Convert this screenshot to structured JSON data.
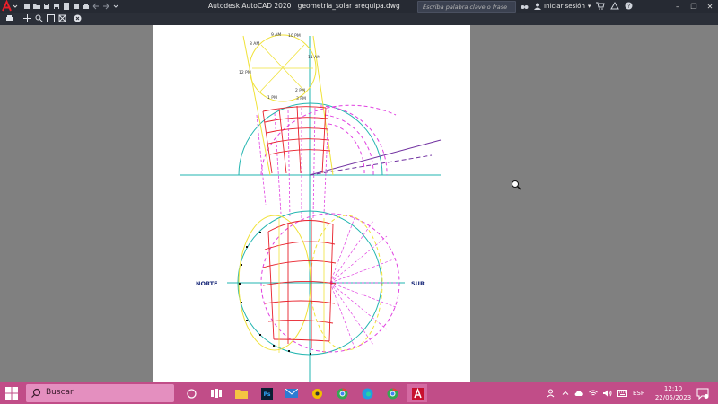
{
  "titlebar": {
    "app_name": "Autodesk AutoCAD 2020",
    "file_name": "geometria_solar arequipa.dwg",
    "search_placeholder": "Escriba palabra clave o frase",
    "signin_label": "Iniciar sesión"
  },
  "drawing": {
    "labels": {
      "norte": "NORTE",
      "sur": "SUR"
    },
    "hour_labels": [
      "8 AM",
      "9 AM",
      "10 PM",
      "11 AM",
      "12 PM",
      "1 PM",
      "2 PM",
      "3 PM"
    ],
    "colors": {
      "cyan": "#22b5b0",
      "magenta": "#e040e0",
      "yellow": "#f0e23a",
      "red": "#e8202a",
      "purple": "#7030a0",
      "navy": "#1a2a7a"
    }
  },
  "taskbar": {
    "search_label": "Buscar",
    "language": "ESP",
    "time": "12:10",
    "date": "22/05/2023"
  },
  "icons": {
    "app_menu": "autocad-a-icon",
    "windows": "windows-logo-icon",
    "search": "magnifier-icon"
  }
}
